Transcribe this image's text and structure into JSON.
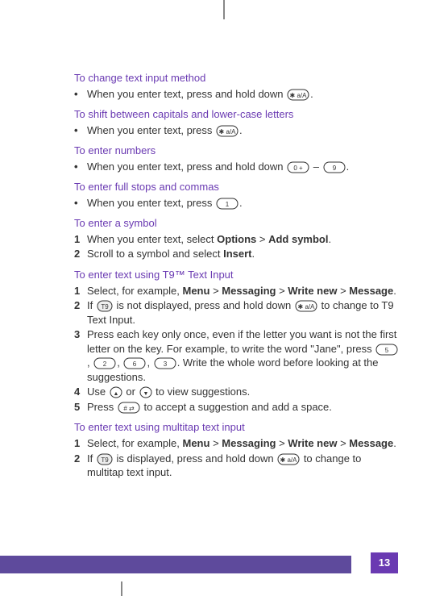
{
  "page_number": "13",
  "sections": [
    {
      "title": "To change text input method",
      "type": "bullet",
      "items": [
        {
          "prefix": "When you enter text, press and hold down ",
          "keys": [
            "aA"
          ],
          "suffix": "."
        }
      ]
    },
    {
      "title": "To shift between capitals and lower-case letters",
      "type": "bullet",
      "items": [
        {
          "prefix": "When you enter text, press ",
          "keys": [
            "aA"
          ],
          "suffix": "."
        }
      ]
    },
    {
      "title": "To enter numbers",
      "type": "bullet",
      "items": [
        {
          "prefix": "When you enter text, press and hold down ",
          "keys": [
            "0"
          ],
          "mid": " – ",
          "keys2": [
            "9"
          ],
          "suffix": "."
        }
      ]
    },
    {
      "title": "To enter full stops and commas",
      "type": "bullet",
      "items": [
        {
          "prefix": "When you enter text, press ",
          "keys": [
            "1"
          ],
          "suffix": "."
        }
      ]
    },
    {
      "title": "To enter a symbol",
      "type": "numbered",
      "items": [
        {
          "n": "1",
          "parts": [
            {
              "t": "When you enter text, select "
            },
            {
              "b": "Options"
            },
            {
              "t": " > "
            },
            {
              "b": "Add symbol"
            },
            {
              "t": "."
            }
          ]
        },
        {
          "n": "2",
          "parts": [
            {
              "t": "Scroll to a symbol and select "
            },
            {
              "b": "Insert"
            },
            {
              "t": "."
            }
          ]
        }
      ]
    },
    {
      "title": "To enter text using T9™ Text Input",
      "type": "numbered",
      "items": [
        {
          "n": "1",
          "parts": [
            {
              "t": "Select, for example, "
            },
            {
              "b": "Menu"
            },
            {
              "t": " > "
            },
            {
              "b": "Messaging"
            },
            {
              "t": " > "
            },
            {
              "b": "Write new"
            },
            {
              "t": " > "
            },
            {
              "b": "Message"
            },
            {
              "t": "."
            }
          ]
        },
        {
          "n": "2",
          "parts": [
            {
              "t": "If "
            },
            {
              "k": "T9"
            },
            {
              "t": " is not displayed, press and hold down "
            },
            {
              "k": "aA"
            },
            {
              "t": " to change to T9 Text Input."
            }
          ]
        },
        {
          "n": "3",
          "parts": [
            {
              "t": "Press each key only once, even if the letter you want is not the first letter on the key. For example, to write the word \"Jane\", press "
            },
            {
              "k": "5"
            },
            {
              "t": ", "
            },
            {
              "k": "2"
            },
            {
              "t": ", "
            },
            {
              "k": "6"
            },
            {
              "t": ", "
            },
            {
              "k": "3"
            },
            {
              "t": ". Write the whole word before looking at the suggestions."
            }
          ]
        },
        {
          "n": "4",
          "parts": [
            {
              "t": "Use "
            },
            {
              "k": "up"
            },
            {
              "t": " or "
            },
            {
              "k": "down"
            },
            {
              "t": " to view suggestions."
            }
          ]
        },
        {
          "n": "5",
          "parts": [
            {
              "t": "Press "
            },
            {
              "k": "hash"
            },
            {
              "t": " to accept a suggestion and add a space."
            }
          ]
        }
      ]
    },
    {
      "title": "To enter text using multitap text input",
      "type": "numbered",
      "items": [
        {
          "n": "1",
          "parts": [
            {
              "t": "Select, for example, "
            },
            {
              "b": "Menu"
            },
            {
              "t": " > "
            },
            {
              "b": "Messaging"
            },
            {
              "t": " > "
            },
            {
              "b": "Write new"
            },
            {
              "t": " > "
            },
            {
              "b": "Message"
            },
            {
              "t": "."
            }
          ]
        },
        {
          "n": "2",
          "parts": [
            {
              "t": "If "
            },
            {
              "k": "T9"
            },
            {
              "t": " is displayed, press and hold down "
            },
            {
              "k": "aA"
            },
            {
              "t": " to change to multitap text input."
            }
          ]
        }
      ]
    }
  ]
}
